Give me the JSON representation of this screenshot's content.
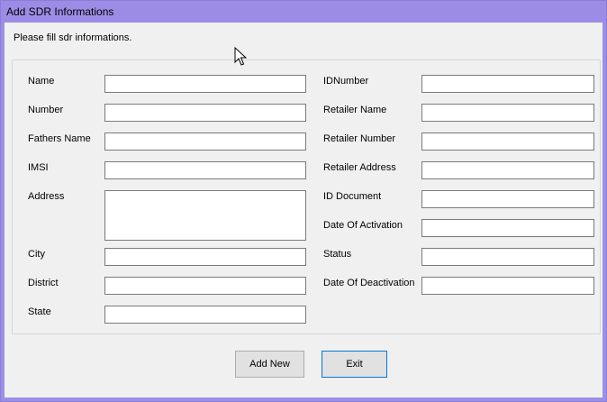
{
  "window": {
    "title": "Add SDR Informations"
  },
  "form": {
    "instruction": "Please fill sdr informations.",
    "left_fields": [
      {
        "label": "Name",
        "value": ""
      },
      {
        "label": "Number",
        "value": ""
      },
      {
        "label": "Fathers Name",
        "value": ""
      },
      {
        "label": "IMSI",
        "value": ""
      },
      {
        "label": "Address",
        "value": ""
      },
      {
        "label": "City",
        "value": ""
      },
      {
        "label": "District",
        "value": ""
      },
      {
        "label": "State",
        "value": ""
      }
    ],
    "right_fields": [
      {
        "label": "IDNumber",
        "value": ""
      },
      {
        "label": "Retailer Name",
        "value": ""
      },
      {
        "label": "Retailer Number",
        "value": ""
      },
      {
        "label": "Retailer Address",
        "value": ""
      },
      {
        "label": "ID Document",
        "value": ""
      },
      {
        "label": "Date Of Activation",
        "value": ""
      },
      {
        "label": "Status",
        "value": ""
      },
      {
        "label": "Date Of Deactivation",
        "value": ""
      }
    ]
  },
  "buttons": {
    "add_new": "Add New",
    "exit": "Exit"
  },
  "icons": {
    "cursor": "mouse-pointer-icon"
  },
  "colors": {
    "titlebar": "#9d8ce6",
    "client_bg": "#f0f0f0"
  }
}
